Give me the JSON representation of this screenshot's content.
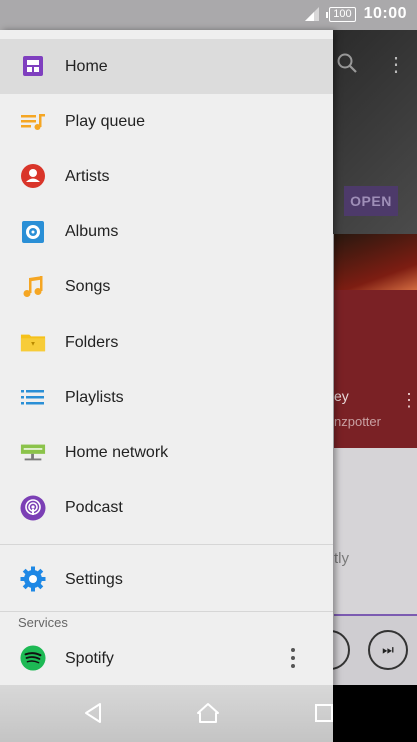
{
  "status_bar": {
    "battery": "100",
    "time": "10:00"
  },
  "background_app": {
    "open_button": "OPEN",
    "now_playing_title": "ey",
    "now_playing_artist": "nzpotter",
    "partial_text": "tly"
  },
  "drawer": {
    "menu_items": [
      {
        "label": "Home",
        "icon": "home-grid-icon",
        "selected": true
      },
      {
        "label": "Play queue",
        "icon": "play-queue-icon"
      },
      {
        "label": "Artists",
        "icon": "artist-icon"
      },
      {
        "label": "Albums",
        "icon": "album-icon"
      },
      {
        "label": "Songs",
        "icon": "music-note-icon"
      },
      {
        "label": "Folders",
        "icon": "folder-icon"
      },
      {
        "label": "Playlists",
        "icon": "playlist-icon"
      },
      {
        "label": "Home network",
        "icon": "home-network-icon"
      },
      {
        "label": "Podcast",
        "icon": "podcast-icon"
      }
    ],
    "settings_label": "Settings",
    "services_label": "Services",
    "spotify_label": "Spotify"
  },
  "colors": {
    "home_purple": "#7f3fbf",
    "queue_orange": "#f5a623",
    "artist_red": "#d9352a",
    "album_blue": "#2a8fd6",
    "folder_yellow": "#f5c11a",
    "playlist_blue": "#2a8fd6",
    "network_green": "#8bc34a",
    "podcast_purple": "#7b3fb5",
    "settings_blue": "#1e88e5",
    "spotify_green": "#1db954"
  }
}
